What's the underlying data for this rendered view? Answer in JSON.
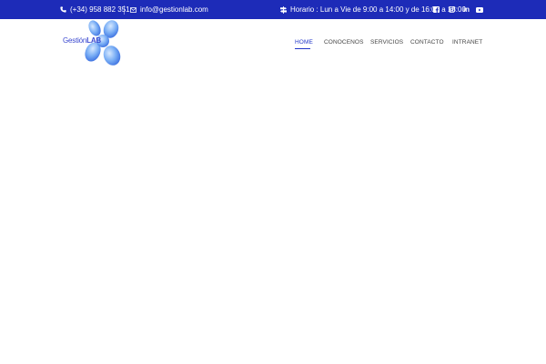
{
  "topbar": {
    "phone": "(+34) 958 882 351",
    "email": "info@gestionlab.com",
    "hours": "Horario : Lun a Vie de 9:00 a 14:00 y de 16:00 a 18:00",
    "social": {
      "facebook_icon": "facebook-icon",
      "instagram_icon": "instagram-icon",
      "linkedin_label": "in",
      "youtube_icon": "youtube-icon"
    },
    "background": "#1d2bb8"
  },
  "logo": {
    "name_light": "Gestión",
    "name_bold": "LAB",
    "color": "#3c4ad0"
  },
  "nav": {
    "items": [
      {
        "label": "HOME",
        "active": true
      },
      {
        "label": "CONOCENOS",
        "active": false
      },
      {
        "label": "SERVICIOS",
        "active": false
      },
      {
        "label": "CONTACTO",
        "active": false
      },
      {
        "label": "INTRANET",
        "active": false
      }
    ],
    "active_color": "#2136c8"
  }
}
